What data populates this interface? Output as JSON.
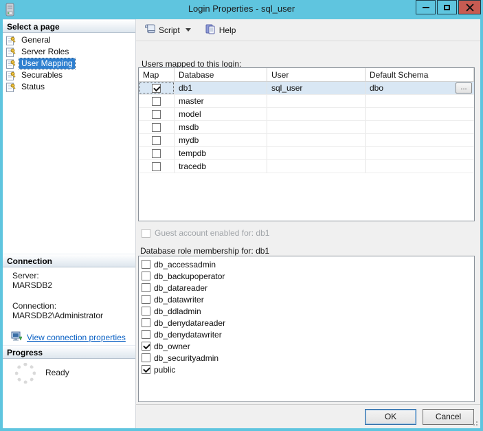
{
  "window": {
    "title": "Login Properties - sql_user"
  },
  "sidebar": {
    "select_page": {
      "header": "Select a page",
      "items": [
        {
          "label": "General",
          "selected": false
        },
        {
          "label": "Server Roles",
          "selected": false
        },
        {
          "label": "User Mapping",
          "selected": true
        },
        {
          "label": "Securables",
          "selected": false
        },
        {
          "label": "Status",
          "selected": false
        }
      ]
    },
    "connection": {
      "header": "Connection",
      "server_label": "Server:",
      "server_value": "MARSDB2",
      "connection_label": "Connection:",
      "connection_value": "MARSDB2\\Administrator",
      "link_label": "View connection properties"
    },
    "progress": {
      "header": "Progress",
      "status": "Ready"
    }
  },
  "toolbar": {
    "script_label": "Script",
    "help_label": "Help"
  },
  "main": {
    "users_mapped_label": "Users mapped to this login:",
    "table": {
      "columns": [
        "Map",
        "Database",
        "User",
        "Default Schema"
      ],
      "browse_label": "...",
      "rows": [
        {
          "map_checked": true,
          "database": "db1",
          "user": "sql_user",
          "default_schema": "dbo",
          "selected": true,
          "has_browse": true
        },
        {
          "map_checked": false,
          "database": "master",
          "user": "",
          "default_schema": "",
          "selected": false,
          "has_browse": false
        },
        {
          "map_checked": false,
          "database": "model",
          "user": "",
          "default_schema": "",
          "selected": false,
          "has_browse": false
        },
        {
          "map_checked": false,
          "database": "msdb",
          "user": "",
          "default_schema": "",
          "selected": false,
          "has_browse": false
        },
        {
          "map_checked": false,
          "database": "mydb",
          "user": "",
          "default_schema": "",
          "selected": false,
          "has_browse": false
        },
        {
          "map_checked": false,
          "database": "tempdb",
          "user": "",
          "default_schema": "",
          "selected": false,
          "has_browse": false
        },
        {
          "map_checked": false,
          "database": "tracedb",
          "user": "",
          "default_schema": "",
          "selected": false,
          "has_browse": false
        }
      ]
    },
    "guest_account_label": "Guest account enabled for: db1",
    "role_membership_label": "Database role membership for: db1",
    "roles": [
      {
        "name": "db_accessadmin",
        "checked": false
      },
      {
        "name": "db_backupoperator",
        "checked": false
      },
      {
        "name": "db_datareader",
        "checked": false
      },
      {
        "name": "db_datawriter",
        "checked": false
      },
      {
        "name": "db_ddladmin",
        "checked": false
      },
      {
        "name": "db_denydatareader",
        "checked": false
      },
      {
        "name": "db_denydatawriter",
        "checked": false
      },
      {
        "name": "db_owner",
        "checked": true
      },
      {
        "name": "db_securityadmin",
        "checked": false
      },
      {
        "name": "public",
        "checked": true
      }
    ]
  },
  "footer": {
    "ok_label": "OK",
    "cancel_label": "Cancel"
  },
  "colors": {
    "titlebar": "#5fc5df",
    "close_button": "#c75b52",
    "selection_blue": "#2f80d0",
    "selected_row": "#d9e7f4",
    "link": "#0b61c4"
  }
}
